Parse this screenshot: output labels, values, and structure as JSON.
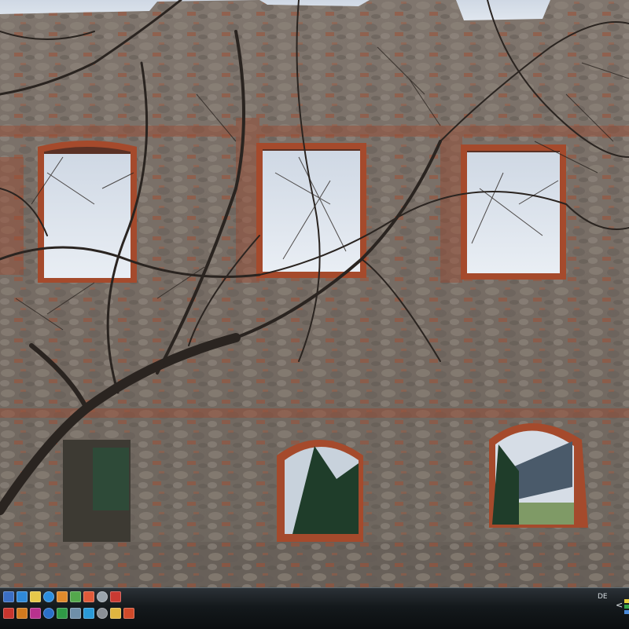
{
  "desktop": {
    "wallpaper_icon": "castle-ruin-wallpaper"
  },
  "taskbar": {
    "quick_launch_top": [
      {
        "name": "show-desktop-icon",
        "color": "#3b6fc4"
      },
      {
        "name": "windows-explorer-icon",
        "color": "#2f89d8"
      },
      {
        "name": "notepad-icon",
        "color": "#e6c84a"
      },
      {
        "name": "internet-explorer-icon",
        "color": "#2c8ee0"
      },
      {
        "name": "messenger-icon",
        "color": "#e08a2c"
      },
      {
        "name": "calculator-icon",
        "color": "#54a84c"
      },
      {
        "name": "media-player-icon",
        "color": "#e05a3a"
      },
      {
        "name": "camera-icon",
        "color": "#9aa4ad"
      },
      {
        "name": "paint-icon",
        "color": "#c93a32"
      }
    ],
    "quick_launch_bottom": [
      {
        "name": "acrobat-icon",
        "color": "#c8352e"
      },
      {
        "name": "photoshop-icon",
        "color": "#d17a1e"
      },
      {
        "name": "word-icon",
        "color": "#b8328e"
      },
      {
        "name": "powerpoint-icon",
        "color": "#2a6fc9"
      },
      {
        "name": "excel-icon",
        "color": "#2f9a46"
      },
      {
        "name": "network-icon",
        "color": "#6f8fa8"
      },
      {
        "name": "skype-icon",
        "color": "#2a9ad8"
      },
      {
        "name": "tools-icon",
        "color": "#8a8f96"
      },
      {
        "name": "folder-icon",
        "color": "#e0b540"
      },
      {
        "name": "media-icon",
        "color": "#d04a2a"
      }
    ],
    "language": "DE",
    "tray_arrow": "<",
    "tray_colors": [
      "#e8d040",
      "#3aa64a",
      "#4a8ad8"
    ]
  }
}
